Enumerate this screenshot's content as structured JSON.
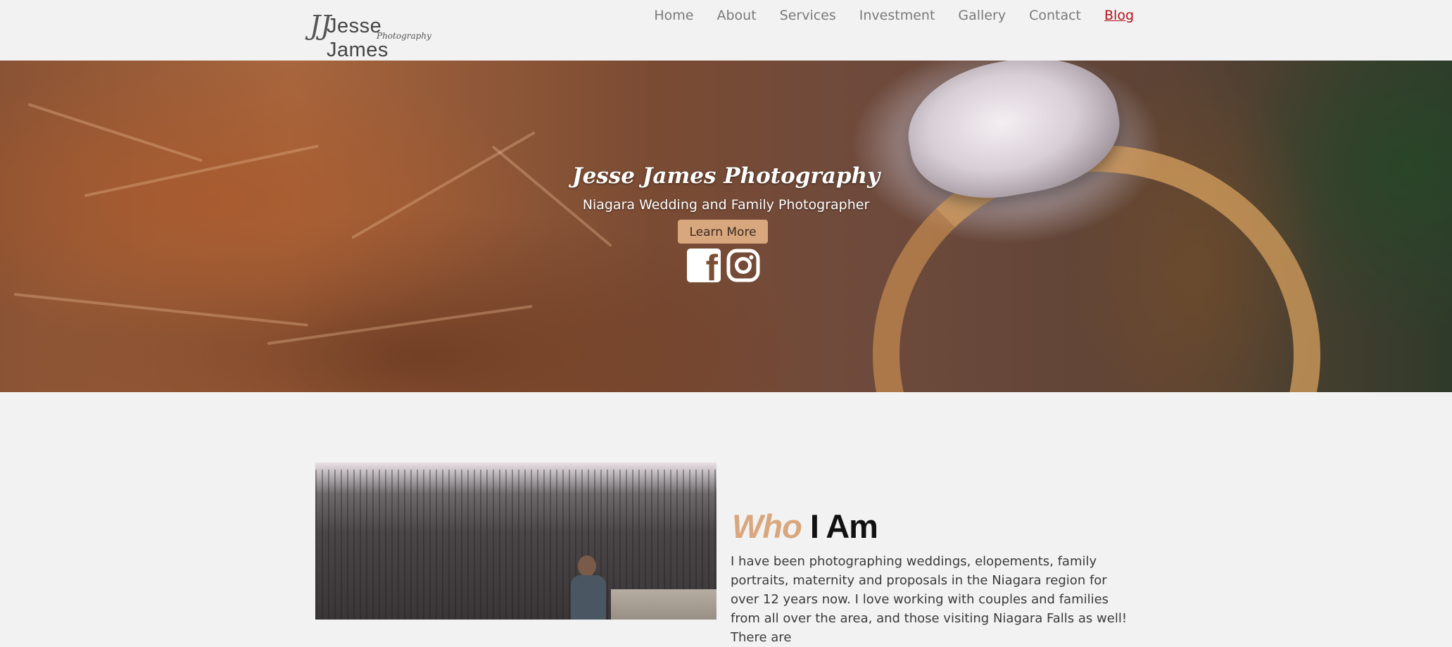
{
  "header": {
    "logo_mono": "JJ",
    "logo_name": "Jesse James",
    "logo_sub": "Photography",
    "nav": [
      {
        "label": "Home"
      },
      {
        "label": "About"
      },
      {
        "label": "Services"
      },
      {
        "label": "Investment"
      },
      {
        "label": "Gallery"
      },
      {
        "label": "Contact"
      },
      {
        "label": "Blog",
        "active": true
      }
    ],
    "active_color": "#b3121a"
  },
  "hero": {
    "title": "Jesse James Photography",
    "subtitle": "Niagara Wedding and Family Photographer",
    "button_label": "Learn More",
    "button_color": "#d8a77e",
    "social": [
      {
        "icon": "facebook-icon",
        "glyph": "f"
      },
      {
        "icon": "instagram-icon"
      }
    ]
  },
  "about": {
    "title_accent": "Who",
    "title_rest": " I Am",
    "body": "I have been photographing weddings, elopements, family portraits, maternity and proposals in the Niagara region for over 12 years now. I love working with couples and families from all over the area, and those visiting Niagara Falls as well! There are"
  }
}
